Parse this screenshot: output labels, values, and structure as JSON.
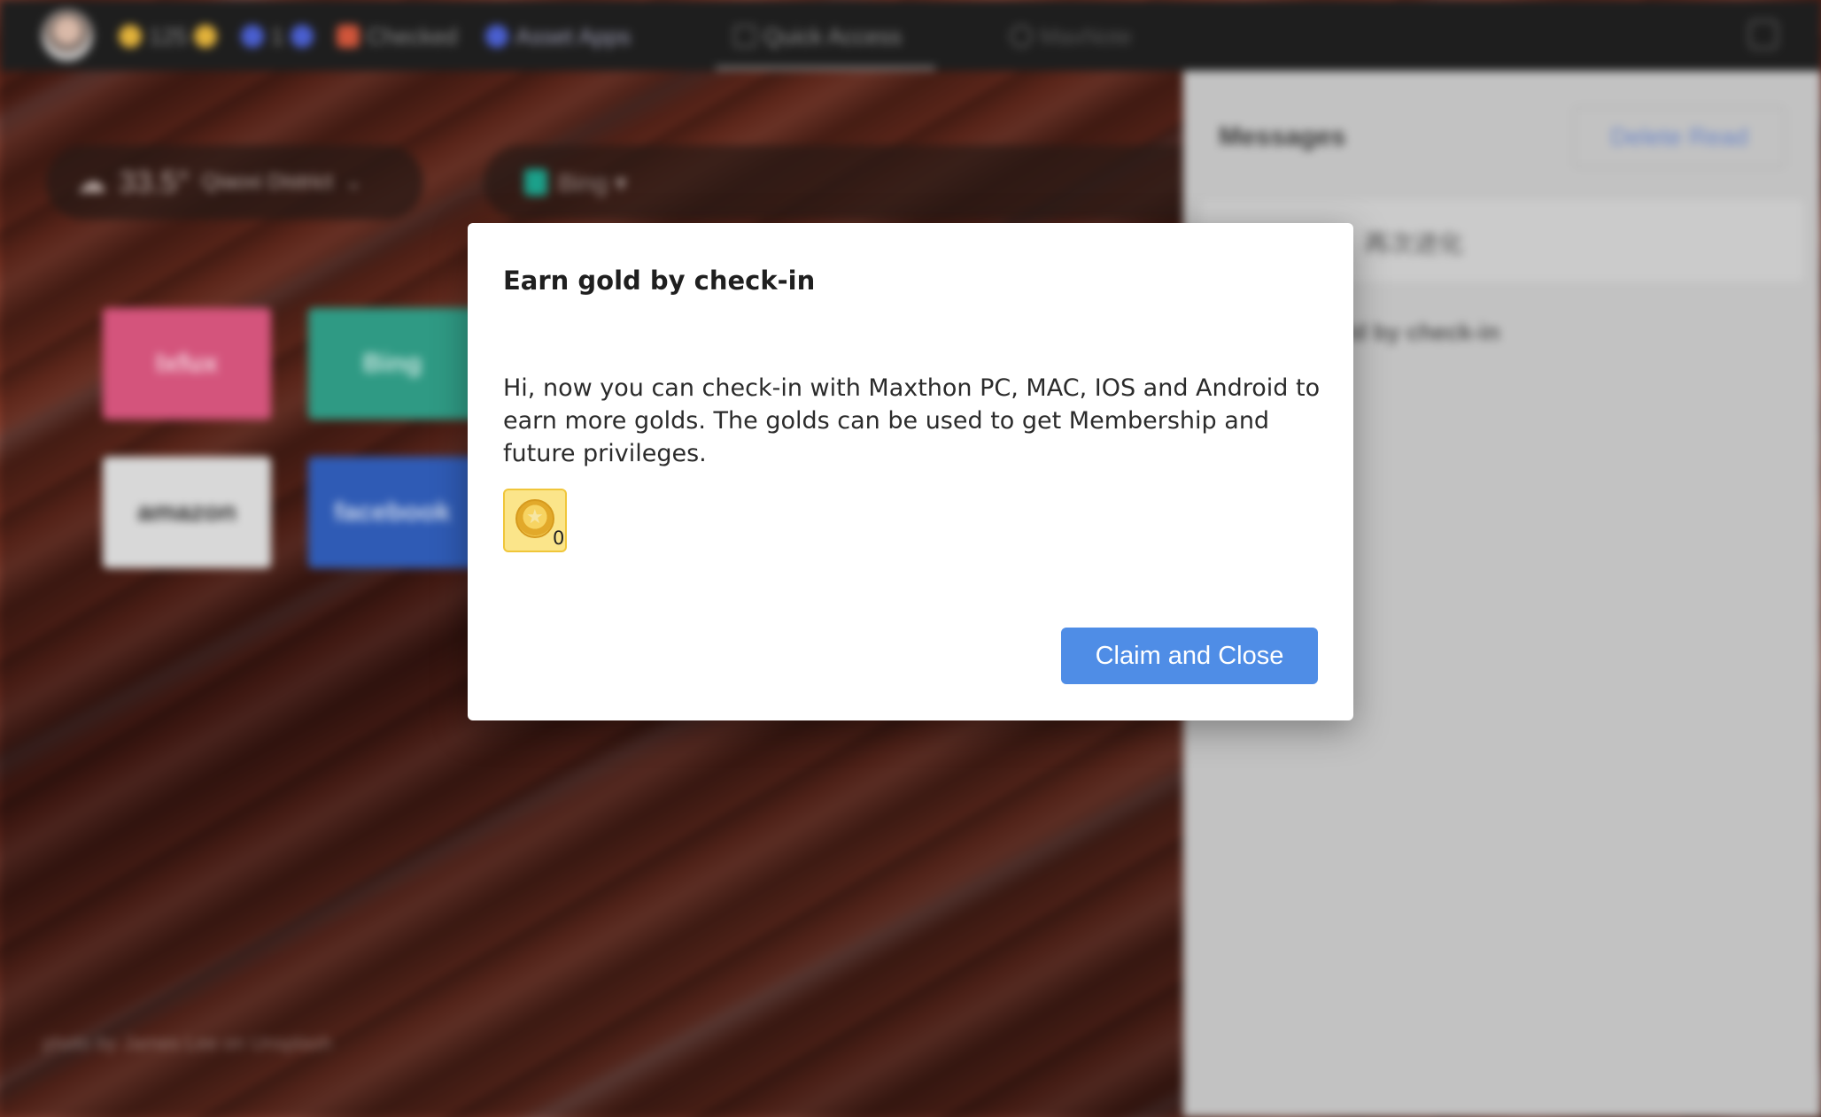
{
  "topbar": {
    "coins_count": "125",
    "checked_label": "Checked",
    "asset_apps_label": "Asset Apps",
    "quick_access_label": "Quick Access",
    "maxnote_label": "MaxNote",
    "badge_1": "1"
  },
  "weather": {
    "temperature": "33.5°",
    "location": "Qiaoxi District"
  },
  "search": {
    "engine": "Bing ▾"
  },
  "tiles": [
    {
      "label": "Ixfux",
      "color": "#d4547c"
    },
    {
      "label": "Bing",
      "color": "#2f9a84"
    },
    {
      "label": "amazon",
      "color": "#d8d8d8"
    },
    {
      "label": "facebook",
      "color": "#2f5bb5"
    }
  ],
  "photo_credit": "photo by James Lee on Unsplash",
  "messages": {
    "title": "Messages",
    "delete_read_label": "Delete Read",
    "row_text": "再次进化",
    "sub_text": "ld by check-in"
  },
  "dialog": {
    "title": "Earn gold by check-in",
    "body": "Hi, now you can check-in with Maxthon PC, MAC, IOS and Android to earn more golds. The golds can be used to get Membership and future privileges.",
    "coin_count": "0",
    "claim_button": "Claim and Close"
  },
  "colors": {
    "accent_button": "#4f8de6",
    "coin_bg": "#fbe58a"
  }
}
